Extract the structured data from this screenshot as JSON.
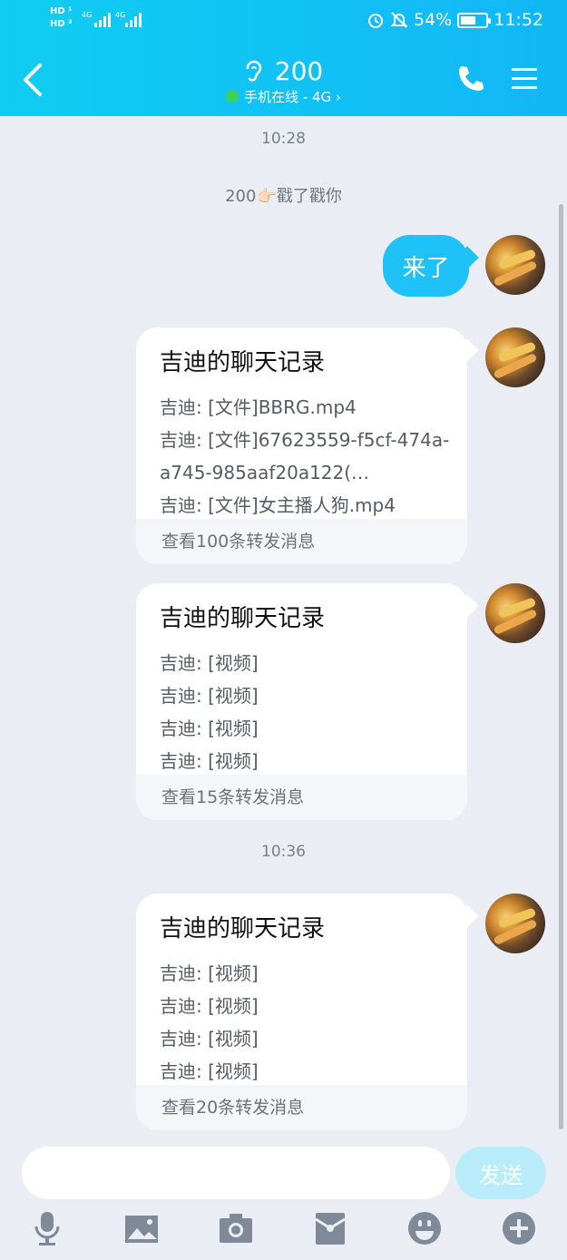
{
  "status_bar": {
    "network": "4G",
    "battery": "54%",
    "time": "11:52"
  },
  "header": {
    "title": "200",
    "subtitle": "手机在线 - 4G"
  },
  "chat": {
    "time_1": "10:28",
    "poke": "200👉🏻戳了戳你",
    "my_message": "来了",
    "cards": [
      {
        "title": "吉迪的聊天记录",
        "lines": [
          "吉迪: [文件]BBRG.mp4",
          "吉迪: [文件]67623559-f5cf-474a-",
          "a745-985aaf20a122(…",
          "吉迪: [文件]女主播人狗.mp4"
        ],
        "footer": "查看100条转发消息"
      },
      {
        "title": "吉迪的聊天记录",
        "lines": [
          "吉迪: [视频]",
          "吉迪: [视频]",
          "吉迪: [视频]",
          "吉迪: [视频]"
        ],
        "footer": "查看15条转发消息"
      },
      {
        "title": "吉迪的聊天记录",
        "lines": [
          "吉迪: [视频]",
          "吉迪: [视频]",
          "吉迪: [视频]",
          "吉迪: [视频]"
        ],
        "footer": "查看20条转发消息"
      }
    ],
    "time_2": "10:36"
  },
  "input_bar": {
    "send_label": "发送",
    "tools": [
      "microphone-icon",
      "image-icon",
      "camera-icon",
      "red-packet-icon",
      "emoji-icon",
      "plus-icon"
    ]
  },
  "colors": {
    "header": "#12b7f6",
    "my_bubble": "#1ec2f6",
    "send_disabled": "#b9ecfb",
    "background": "#eaedf4"
  }
}
